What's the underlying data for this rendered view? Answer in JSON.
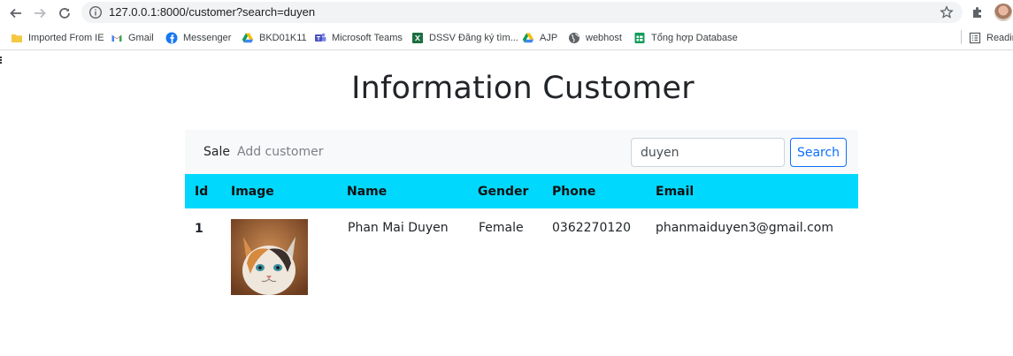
{
  "browser": {
    "url": "127.0.0.1:8000/customer?search=duyen",
    "bookmarks": [
      {
        "label": "Imported From IE",
        "icon": "folder-icon"
      },
      {
        "label": "Gmail",
        "icon": "gmail-icon"
      },
      {
        "label": "Messenger",
        "icon": "messenger-icon"
      },
      {
        "label": "BKD01K11",
        "icon": "google-drive-icon"
      },
      {
        "label": "Microsoft Teams",
        "icon": "teams-icon"
      },
      {
        "label": "DSSV Đăng ký tìm...",
        "icon": "excel-icon"
      },
      {
        "label": "AJP",
        "icon": "google-drive-icon"
      },
      {
        "label": "webhost",
        "icon": "globe-icon"
      },
      {
        "label": "Tổng hợp Database",
        "icon": "sheets-icon"
      }
    ],
    "reading_list": "Readin"
  },
  "page": {
    "title": "Information Customer",
    "nav": {
      "sale": "Sale",
      "add_customer": "Add customer",
      "search_value": "duyen",
      "search_button": "Search"
    },
    "table": {
      "headers": [
        "Id",
        "Image",
        "Name",
        "Gender",
        "Phone",
        "Email"
      ],
      "rows": [
        {
          "id": "1",
          "image": "cat-photo",
          "name": "Phan Mai Duyen",
          "gender": "Female",
          "phone": "0362270120",
          "email": "phanmaiduyen3@gmail.com"
        }
      ]
    }
  },
  "colors": {
    "table_header": "#00d8fe",
    "primary": "#0d6efd",
    "navbar_bg": "#f8f9fa"
  }
}
